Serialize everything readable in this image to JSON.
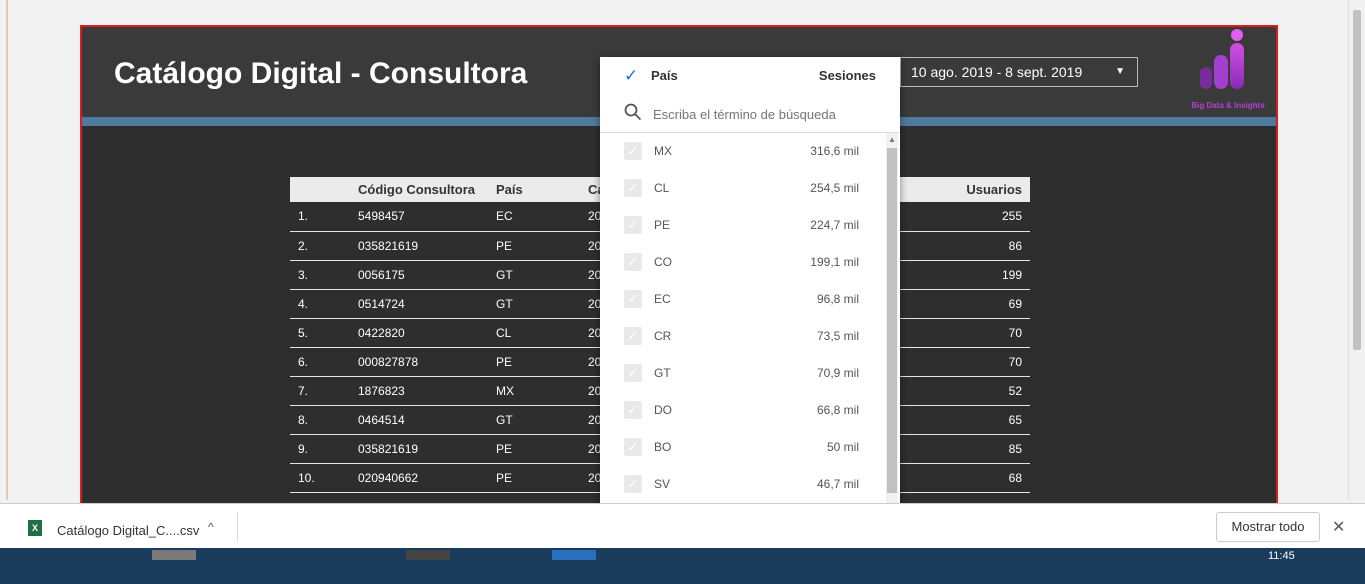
{
  "report": {
    "title": "Catálogo Digital - Consultora",
    "date_range": "10 ago. 2019 - 8 sept. 2019",
    "logo_text": "Big Data & Insights"
  },
  "table": {
    "headers": [
      "",
      "Código Consultora",
      "País",
      "Ca",
      "Usuarios"
    ],
    "rows": [
      {
        "n": "1.",
        "code": "5498457",
        "pais": "EC",
        "c": "20",
        "usuarios": "255"
      },
      {
        "n": "2.",
        "code": "035821619",
        "pais": "PE",
        "c": "20",
        "usuarios": "86"
      },
      {
        "n": "3.",
        "code": "0056175",
        "pais": "GT",
        "c": "20",
        "usuarios": "199"
      },
      {
        "n": "4.",
        "code": "0514724",
        "pais": "GT",
        "c": "20",
        "usuarios": "69"
      },
      {
        "n": "5.",
        "code": "0422820",
        "pais": "CL",
        "c": "20",
        "usuarios": "70"
      },
      {
        "n": "6.",
        "code": "000827878",
        "pais": "PE",
        "c": "20",
        "usuarios": "70"
      },
      {
        "n": "7.",
        "code": "1876823",
        "pais": "MX",
        "c": "20",
        "usuarios": "52"
      },
      {
        "n": "8.",
        "code": "0464514",
        "pais": "GT",
        "c": "20",
        "usuarios": "65"
      },
      {
        "n": "9.",
        "code": "035821619",
        "pais": "PE",
        "c": "20",
        "usuarios": "85"
      },
      {
        "n": "10.",
        "code": "020940662",
        "pais": "PE",
        "c": "20",
        "usuarios": "68"
      }
    ]
  },
  "filter_dropdown": {
    "label": "País",
    "metric_label": "Sesiones",
    "search_placeholder": "Escriba el término de búsqueda",
    "items": [
      {
        "code": "MX",
        "value": "316,6 mil"
      },
      {
        "code": "CL",
        "value": "254,5 mil"
      },
      {
        "code": "PE",
        "value": "224,7 mil"
      },
      {
        "code": "CO",
        "value": "199,1 mil"
      },
      {
        "code": "EC",
        "value": "96,8 mil"
      },
      {
        "code": "CR",
        "value": "73,5 mil"
      },
      {
        "code": "GT",
        "value": "70,9 mil"
      },
      {
        "code": "DO",
        "value": "66,8 mil"
      },
      {
        "code": "BO",
        "value": "50 mil"
      },
      {
        "code": "SV",
        "value": "46,7 mil"
      }
    ]
  },
  "download_bar": {
    "file_name": "Catálogo Digital_C....csv",
    "file_icon": "excel-file-icon",
    "show_all": "Mostrar todo"
  },
  "taskbar": {
    "clock": "11:45"
  },
  "colors": {
    "report_bg": "#2e2e2e",
    "accent_bar": "#4f7aa0",
    "check_blue": "#1a73e8",
    "logo_purple": "#b040d0",
    "border_red": "#d81e1e"
  }
}
